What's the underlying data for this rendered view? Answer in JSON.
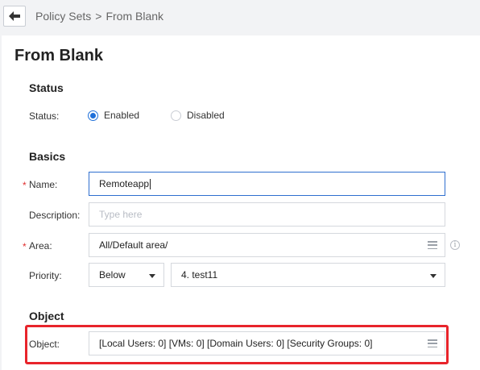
{
  "breadcrumb": {
    "parent": "Policy Sets",
    "separator": ">",
    "current": "From Blank"
  },
  "page": {
    "title": "From Blank"
  },
  "status_section": {
    "title": "Status",
    "label": "Status:",
    "options": {
      "enabled": "Enabled",
      "disabled": "Disabled"
    },
    "selected": "Enabled"
  },
  "basics_section": {
    "title": "Basics",
    "name": {
      "label": "Name:",
      "value": "Remoteapp",
      "required_marker": "*"
    },
    "description": {
      "label": "Description:",
      "placeholder": "Type here"
    },
    "area": {
      "label": "Area:",
      "value": "All/Default area/",
      "required_marker": "*"
    },
    "priority": {
      "label": "Priority:",
      "position_value": "Below",
      "reference_value": "4. test11"
    }
  },
  "object_section": {
    "title": "Object",
    "label": "Object:",
    "value": "[Local Users: 0] [VMs: 0] [Domain Users: 0] [Security Groups: 0]"
  },
  "colors": {
    "accent": "#1e6fd9",
    "required": "#e03030",
    "highlight": "#e8242b"
  }
}
